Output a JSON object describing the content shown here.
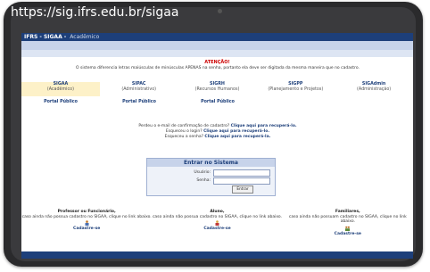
{
  "browser": {
    "url": "https://sig.ifrs.edu.br/sigaa"
  },
  "header": {
    "system_name": "IFRS - SIGAA -",
    "subtitle": "Acadêmico"
  },
  "warning": {
    "title": "ATENÇÃO!",
    "text": "O sistema diferencia letras maiúsculas de minúsculas APENAS na senha, portanto ela deve ser digitada da mesma maneira que no cadastro."
  },
  "systems": [
    {
      "name": "SIGAA",
      "desc": "(Acadêmico)",
      "portal": "Portal Público"
    },
    {
      "name": "SIPAC",
      "desc": "(Administrativo)",
      "portal": "Portal Público"
    },
    {
      "name": "SIGRH",
      "desc": "(Recursos Humanos)",
      "portal": "Portal Público"
    },
    {
      "name": "SIGPP",
      "desc": "(Planejamento e Projetos)",
      "portal": ""
    },
    {
      "name": "SIGAdmin",
      "desc": "(Administração)",
      "portal": ""
    }
  ],
  "links": {
    "line1": "Perdeu o e-mail de confirmação de cadastro?",
    "line1_link": "Clique aqui para recuperá-lo.",
    "line2": "Esqueceu o login?",
    "line2_link": "Clique aqui para recuperá-lo.",
    "line3": "Esqueceu a senha?",
    "line3_link": "Clique aqui para recuperá-la."
  },
  "login": {
    "title": "Entrar no Sistema",
    "user_label": "Usuário:",
    "pass_label": "Senha:",
    "submit": "Entrar"
  },
  "footer": [
    {
      "title": "Professor ou Funcionário,",
      "text": "caso ainda não possua cadastro no SIGAA, clique no link abaixo.",
      "link": "Cadastre-se"
    },
    {
      "title": "Aluno,",
      "text": "caso ainda não possua cadastro no SIGAA, clique no link abaixo.",
      "link": "Cadastre-se"
    },
    {
      "title": "Familiares,",
      "text": "caso ainda não possuam cadastro no SIGAA, clique no link abaixo.",
      "link": "Cadastre-se"
    }
  ],
  "colors": {
    "brand": "#1d3f7a",
    "warning": "#cc0000",
    "active_system": "#fdf1c8"
  }
}
